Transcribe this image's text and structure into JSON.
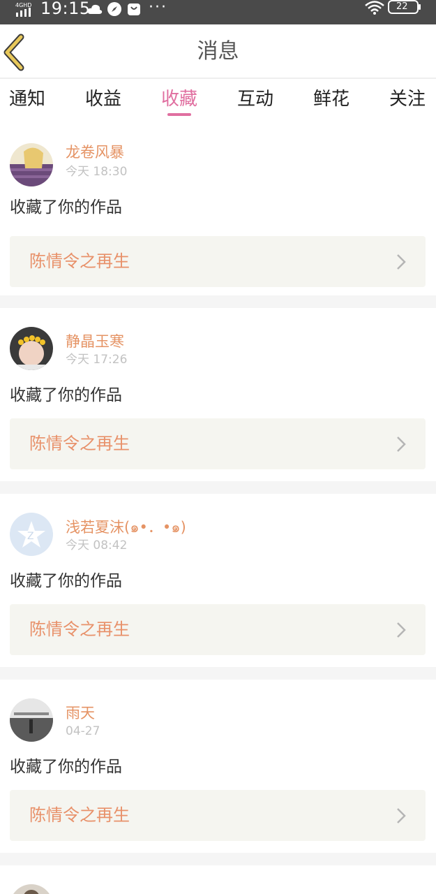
{
  "status_bar": {
    "network": "4GHD",
    "time": "19:15",
    "more": "···",
    "battery": "22"
  },
  "header": {
    "title": "消息"
  },
  "tabs": [
    {
      "label": "通知",
      "active": false
    },
    {
      "label": "收益",
      "active": false
    },
    {
      "label": "收藏",
      "active": true
    },
    {
      "label": "互动",
      "active": false
    },
    {
      "label": "鲜花",
      "active": false
    },
    {
      "label": "关注",
      "active": false
    }
  ],
  "messages": [
    {
      "user": "龙卷风暴",
      "time": "今天 18:30",
      "action": "收藏了你的作品",
      "work": "陈情令之再生"
    },
    {
      "user": "静晶玉寒",
      "time": "今天 17:26",
      "action": "收藏了你的作品",
      "work": "陈情令之再生"
    },
    {
      "user": "浅若夏沫(๑•．•๑)",
      "time": "今天 08:42",
      "action": "收藏了你的作品",
      "work": "陈情令之再生"
    },
    {
      "user": "雨天",
      "time": "04-27",
      "action": "收藏了你的作品",
      "work": "陈情令之再生"
    }
  ],
  "colors": {
    "accent_pink": "#e06fa0",
    "username_orange": "#e59364",
    "work_orange": "#e8916a",
    "card_bg": "#f5f5f0",
    "back_arrow": "#e8c85a"
  }
}
